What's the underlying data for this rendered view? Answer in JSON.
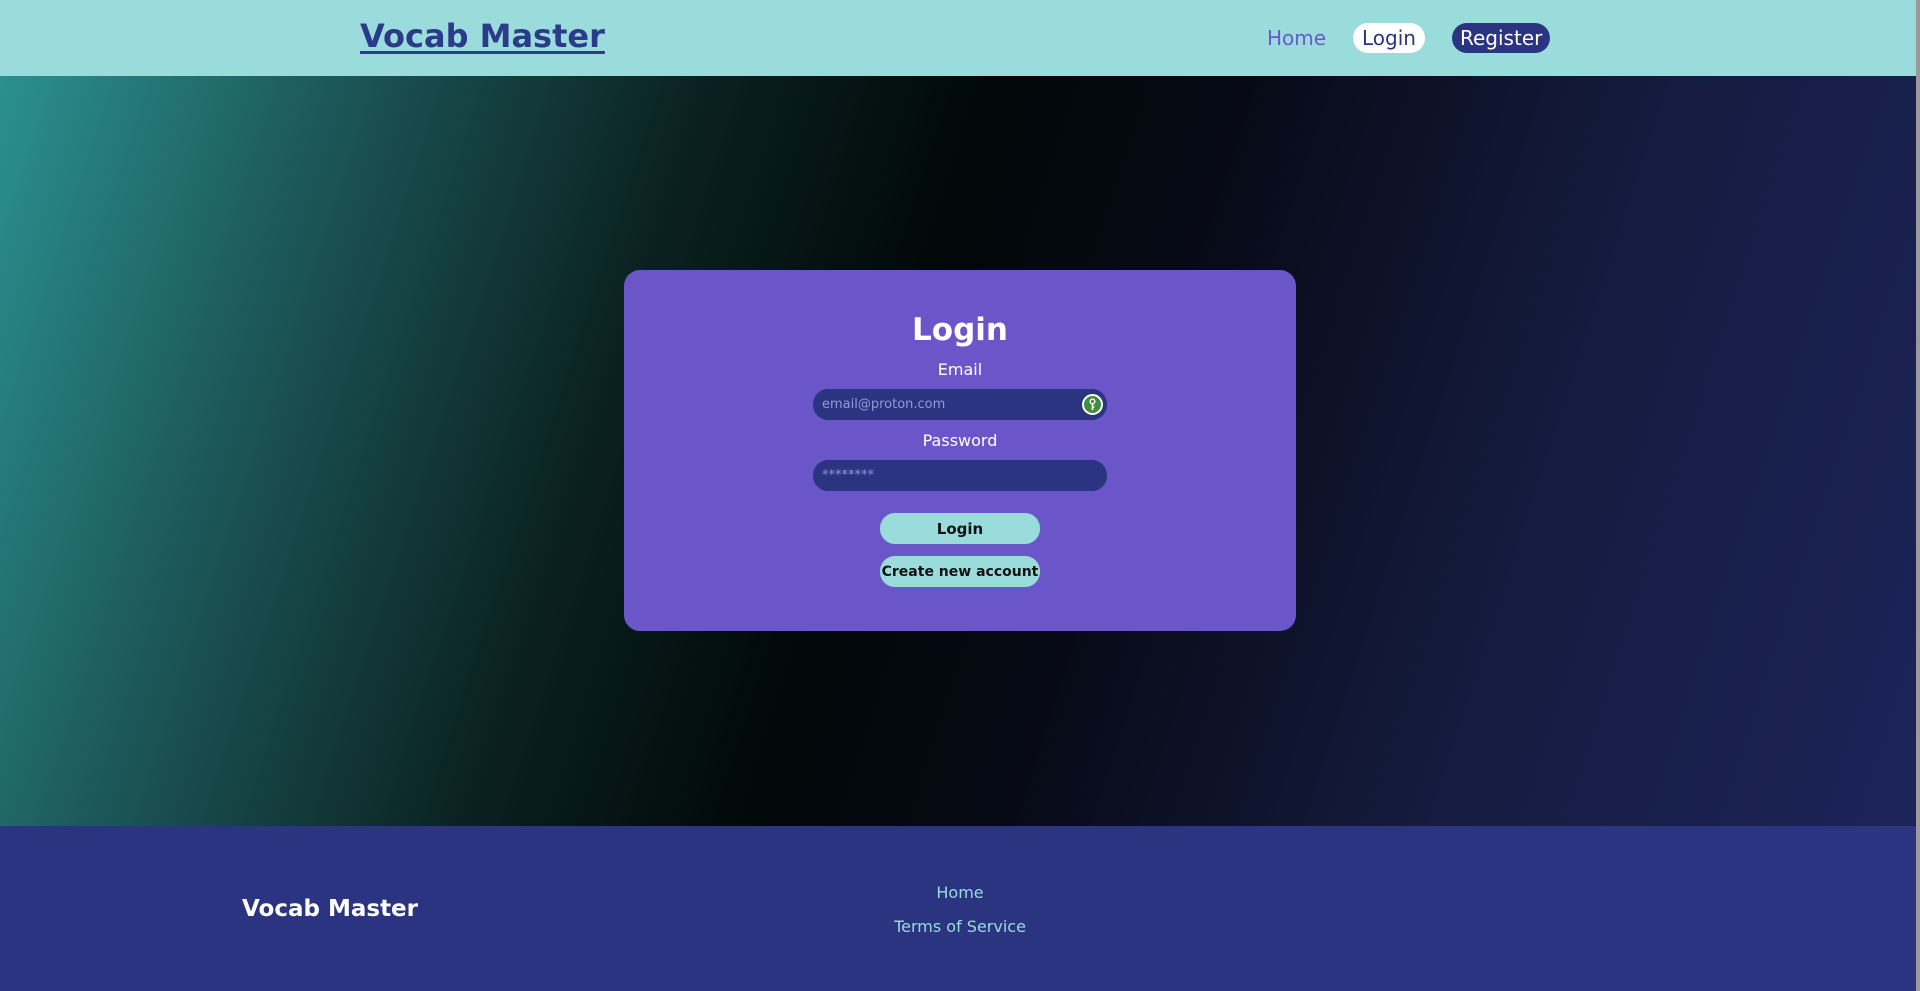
{
  "header": {
    "brand": "Vocab Master",
    "nav": {
      "home": "Home",
      "login": "Login",
      "register": "Register"
    }
  },
  "login_form": {
    "title": "Login",
    "email_label": "Email",
    "email_placeholder": "email@proton.com",
    "email_value": "",
    "password_label": "Password",
    "password_placeholder": "********",
    "password_value": "",
    "login_button": "Login",
    "create_account_button": "Create new account",
    "autofill_icon": "password-manager-icon"
  },
  "footer": {
    "brand": "Vocab Master",
    "links": [
      "Home",
      "Terms of Service"
    ]
  },
  "colors": {
    "header_bg": "#9adcdc",
    "brand_text": "#2b3b8a",
    "card_bg": "#6a56c8",
    "input_bg": "#2b3480",
    "button_bg": "#9adcdc",
    "footer_bg": "#2b3480",
    "footer_link": "#9adcdc"
  }
}
